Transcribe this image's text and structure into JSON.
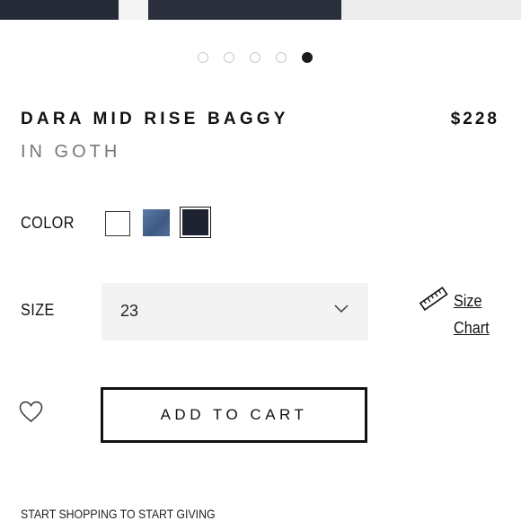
{
  "carousel": {
    "count": 5,
    "active_index": 4
  },
  "product": {
    "name": "DARA MID RISE BAGGY",
    "price": "$228",
    "color_subtitle": "IN GOTH"
  },
  "color": {
    "label": "COLOR",
    "swatches": [
      {
        "name": "white",
        "hex": "#ffffff"
      },
      {
        "name": "blue",
        "hex": "#4a6790"
      },
      {
        "name": "goth",
        "hex": "#1f2230",
        "selected": true
      }
    ]
  },
  "size": {
    "label": "SIZE",
    "selected_value": "23",
    "size_chart_link_line1": "Size",
    "size_chart_link_line2": "Chart"
  },
  "actions": {
    "add_to_cart_label": "ADD TO CART"
  },
  "footer": {
    "text": "START SHOPPING TO START GIVING"
  }
}
